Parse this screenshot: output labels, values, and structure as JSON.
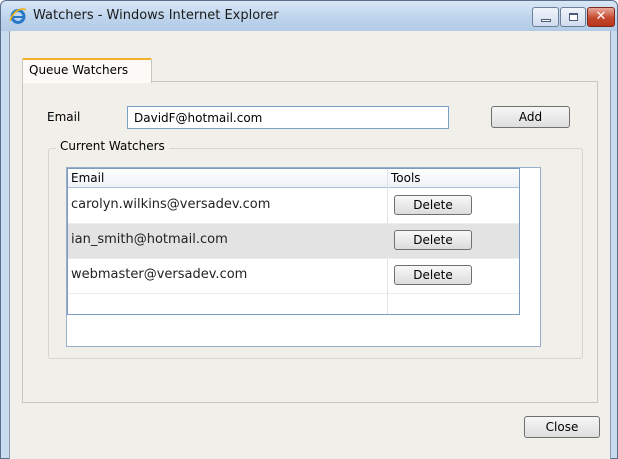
{
  "window": {
    "title": "Watchers - Windows Internet Explorer",
    "close_glyph": "✕"
  },
  "tabs": [
    {
      "label": "Queue Watchers"
    }
  ],
  "form": {
    "email_label": "Email",
    "email_value": "DavidF@hotmail.com",
    "add_label": "Add"
  },
  "watchers": {
    "legend": "Current Watchers",
    "columns": [
      "Email",
      "Tools"
    ],
    "rows": [
      {
        "email": "carolyn.wilkins@versadev.com",
        "action": "Delete"
      },
      {
        "email": "ian_smith@hotmail.com",
        "action": "Delete"
      },
      {
        "email": "webmaster@versadev.com",
        "action": "Delete"
      }
    ]
  },
  "footer": {
    "close_label": "Close"
  },
  "colors": {
    "tab_accent": "#f0b128",
    "close_button": "#c5492f"
  }
}
